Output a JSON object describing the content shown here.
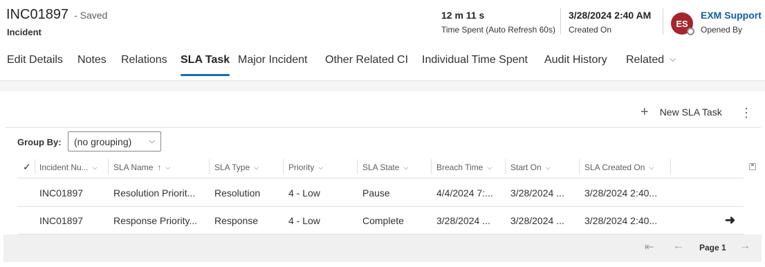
{
  "record": {
    "id": "INC01897",
    "save_status": "- Saved",
    "entity": "Incident"
  },
  "header_fields": {
    "time_spent": {
      "value": "12 m 11 s",
      "label": "Time Spent (Auto Refresh 60s)"
    },
    "created_on": {
      "value": "3/28/2024 2:40 AM",
      "label": "Created On"
    },
    "opened_by": {
      "initials": "ES",
      "value": "EXM Support",
      "label": "Opened By"
    }
  },
  "tabs": [
    {
      "label": "Edit Details"
    },
    {
      "label": "Notes"
    },
    {
      "label": "Relations"
    },
    {
      "label": "SLA Task",
      "active": true
    },
    {
      "label": "Major Incident"
    },
    {
      "label": "Other Related CI"
    },
    {
      "label": "Individual Time Spent"
    },
    {
      "label": "Audit History"
    },
    {
      "label": "Related"
    }
  ],
  "subgrid": {
    "new_button": "New SLA Task",
    "more_icon": "more-vertical-icon",
    "group_by_label": "Group By:",
    "group_by_value": "(no grouping)",
    "columns": [
      "Incident Nu...",
      "SLA Name",
      "SLA Type",
      "Priority",
      "SLA State",
      "Breach Time",
      "Start On",
      "SLA Created On"
    ],
    "rows": [
      [
        "INC01897",
        "Resolution Priorit...",
        "Resolution",
        "4 - Low",
        "Pause",
        "4/4/2024 7:...",
        "3/28/2024 ...",
        "3/28/2024 2:40..."
      ],
      [
        "INC01897",
        "Response Priority...",
        "Response",
        "4 - Low",
        "Complete",
        "3/28/2024 ...",
        "3/28/2024 ...",
        "3/28/2024 2:40..."
      ]
    ]
  },
  "pagination": {
    "page_label": "Page 1"
  },
  "colors": {
    "accent": "#0f6cbd",
    "avatar": "#a4262c",
    "link": "#115ea3"
  }
}
